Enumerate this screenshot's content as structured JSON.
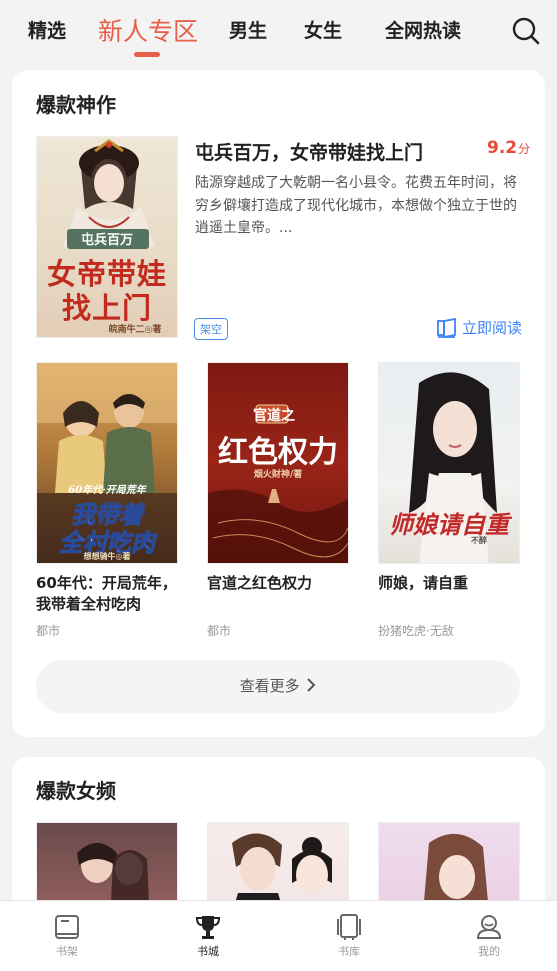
{
  "top_tabs": [
    "精选",
    "新人专区",
    "男生",
    "女生",
    "全网热读"
  ],
  "active_tab": "新人专区",
  "section1": {
    "title": "爆款神作",
    "featured": {
      "title": "屯兵百万，女帝带娃找上门",
      "score": "9.2",
      "score_unit": "分",
      "description": "陆源穿越成了大乾朝一名小县令。花费五年时间，将穷乡僻壤打造成了现代化城市，本想做个独立于世的逍遥土皇帝。...",
      "tag": "架空",
      "read_label": "立即阅读",
      "cover": {
        "small_text": "屯兵百万",
        "big_text_1": "女帝带娃",
        "big_text_2": "找上门",
        "author": "皖南牛二◎著"
      }
    },
    "books": [
      {
        "title": "60年代：开局荒年，我带着全村吃肉",
        "genre": "都市",
        "cover": {
          "line1": "60年代·开局荒年",
          "line2": "我带着",
          "line3": "全村吃肉",
          "author": "想想骑牛◎著"
        }
      },
      {
        "title": "官道之红色权力",
        "genre": "都市",
        "cover": {
          "line1": "官道之",
          "line2": "红色权力",
          "author": "烟火财神/著"
        }
      },
      {
        "title": "师娘，请自重",
        "genre": "扮猪吃虎·无敌",
        "cover": {
          "line1": "师娘请自重",
          "author": "不醉"
        }
      }
    ],
    "more_label": "查看更多"
  },
  "section2": {
    "title": "爆款女频"
  },
  "bottom_nav": [
    {
      "label": "书架",
      "icon": "bookshelf-icon"
    },
    {
      "label": "书城",
      "icon": "trophy-icon"
    },
    {
      "label": "书库",
      "icon": "library-icon"
    },
    {
      "label": "我的",
      "icon": "profile-icon"
    }
  ],
  "colors": {
    "accent": "#e8604a",
    "score": "#e94a3a",
    "link": "#3b82f6"
  }
}
